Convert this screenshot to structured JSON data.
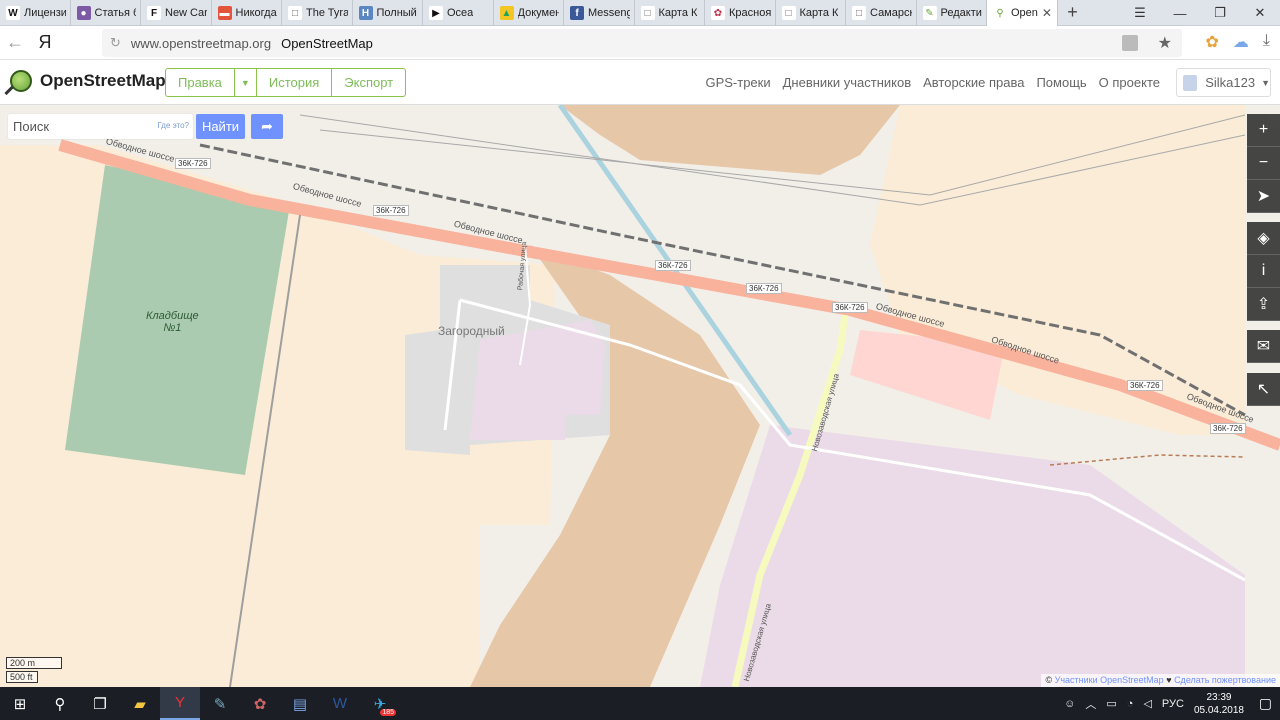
{
  "browser": {
    "tabs": [
      {
        "label": "Лицензи",
        "icon_char": "W",
        "icon_color": "#ffffff",
        "icon_text": "#111111"
      },
      {
        "label": "Статья б",
        "icon_char": "●",
        "icon_color": "#7d5aa6",
        "icon_text": "#ffffff"
      },
      {
        "label": "New Car",
        "icon_char": "F",
        "icon_color": "#ffffff",
        "icon_text": "#111111"
      },
      {
        "label": "Никогда",
        "icon_char": "▬",
        "icon_color": "#e2553b",
        "icon_text": "#ffffff"
      },
      {
        "label": "The Tyra",
        "icon_char": "□",
        "icon_color": "#ffffff",
        "icon_text": "#666666"
      },
      {
        "label": "Полный",
        "icon_char": "Н",
        "icon_color": "#5a86c2",
        "icon_text": "#ffffff"
      },
      {
        "label": "Ocea",
        "icon_char": "▶",
        "icon_color": "#ffffff",
        "icon_text": "#111111"
      },
      {
        "label": "Докумен",
        "icon_char": "▲",
        "icon_color": "#f3c623",
        "icon_text": "#1ea362"
      },
      {
        "label": "Messeng",
        "icon_char": "f",
        "icon_color": "#3b5998",
        "icon_text": "#ffffff"
      },
      {
        "label": "Карта К",
        "icon_char": "□",
        "icon_color": "#ffffff",
        "icon_text": "#666666"
      },
      {
        "label": "Красноя",
        "icon_char": "✿",
        "icon_color": "#ffffff",
        "icon_text": "#c7304a"
      },
      {
        "label": "Карта К",
        "icon_char": "□",
        "icon_color": "#ffffff",
        "icon_text": "#666666"
      },
      {
        "label": "Самарск",
        "icon_char": "□",
        "icon_color": "#ffffff",
        "icon_text": "#666666"
      },
      {
        "label": "Редактир",
        "icon_char": "✎",
        "icon_color": "#ffffff",
        "icon_text": "#6aa33a"
      }
    ],
    "active_tab": {
      "label": "Open",
      "icon_char": "⚲"
    },
    "url_domain": "www.openstreetmap.org",
    "url_title": "OpenStreetMap",
    "ya_label": "Я"
  },
  "osm": {
    "logo_text": "OpenStreetMap",
    "edit_label": "Правка",
    "history_label": "История",
    "export_label": "Экспорт",
    "nav": [
      "GPS-треки",
      "Дневники участников",
      "Авторские права",
      "Помощь",
      "О проекте"
    ],
    "username": "Silka123"
  },
  "search": {
    "placeholder": "Поиск",
    "where_label": "Где это?",
    "find_label": "Найти"
  },
  "map_labels": {
    "obvodnoe": "Обводное шоссе",
    "route": "36К-726",
    "cemetery_line1": "Кладбище",
    "cemetery_line2": "№1",
    "zagorodny": "Загородный",
    "rabochaya": "Рабочая улица",
    "novozavodskaya": "Новозаводская улица"
  },
  "scale": {
    "metric": "200 m",
    "imperial": "500 ft"
  },
  "attribution": {
    "prefix": "©",
    "contributors": "Участники OpenStreetMap",
    "heart": "♥",
    "donate": "Сделать пожертвование"
  },
  "taskbar": {
    "lang": "РУС",
    "time": "23:39",
    "date": "05.04.2018",
    "telegram_badge": "185"
  },
  "colors": {
    "farmland": "#fbecd7",
    "brownfield": "#e6c8a9",
    "residential": "#e0dfdf",
    "industrial": "#ebdbe8",
    "cemetery": "#aacbaf",
    "commercial": "#f2dad9",
    "retail": "#ffd6d1",
    "trunk": "#f9b29c",
    "primary": "#fcd6a4",
    "secondary": "#f7fabf",
    "water": "#aad3df",
    "osm_blue": "#7092ff",
    "osm_green": "#7ebc59"
  }
}
